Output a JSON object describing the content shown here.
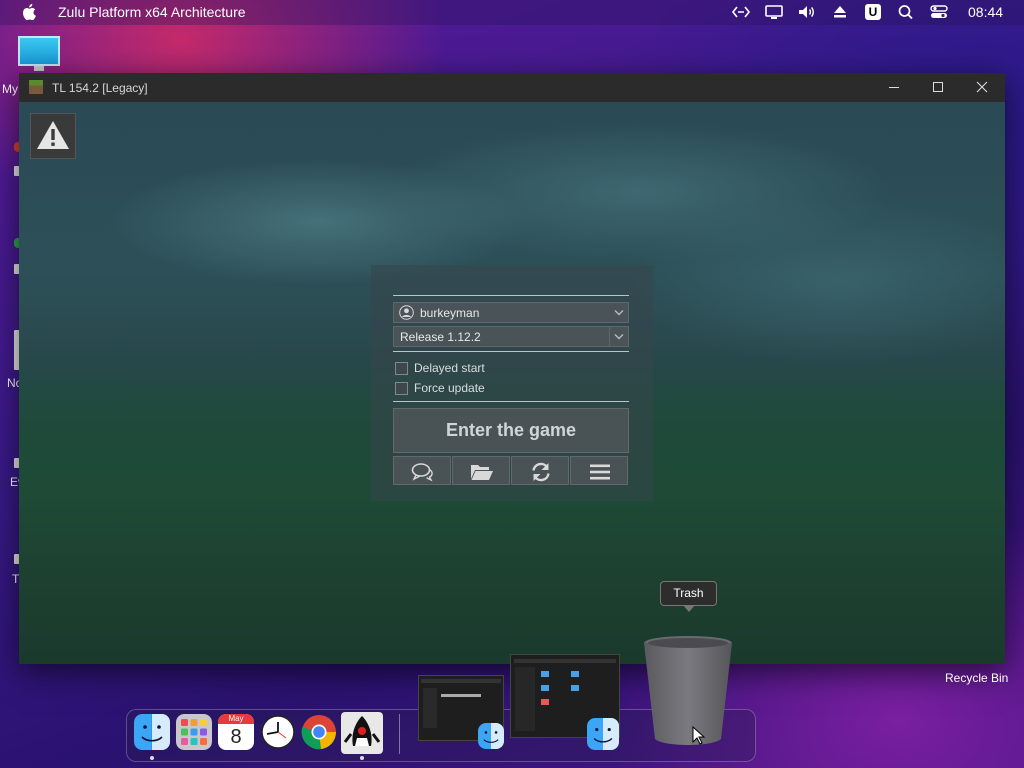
{
  "menubar": {
    "app_title": "Zulu Platform x64 Architecture",
    "clock": "08:44",
    "tray_icons": [
      "code-icon",
      "display-icon",
      "volume-icon",
      "eject-icon",
      "u-badge-icon",
      "search-icon",
      "control-center-icon"
    ],
    "u_badge": "U"
  },
  "window": {
    "title": "TL 154.2 [Legacy]"
  },
  "launcher": {
    "account": "burkeyman",
    "version": "Release 1.12.2",
    "delayed_start_label": "Delayed start",
    "force_update_label": "Force update",
    "delayed_start_checked": false,
    "force_update_checked": false,
    "enter_label": "Enter the game",
    "bottom_buttons": [
      "chat-icon",
      "folder-icon",
      "refresh-icon",
      "menu-icon"
    ]
  },
  "desktop": {
    "icon_labels": [
      "My",
      "No",
      "Ev",
      "T"
    ],
    "recycle_bin_label": "Recycle Bin"
  },
  "dock": {
    "tooltip": "Trash",
    "calendar_month": "May",
    "calendar_day": "8",
    "apps": [
      "finder",
      "launchpad",
      "calendar",
      "clock",
      "chrome",
      "java"
    ]
  },
  "colors": {
    "accent_wallpaper": "#3a1a8a",
    "window_titlebar": "#2b2b2b",
    "panel_button": "#495255"
  }
}
